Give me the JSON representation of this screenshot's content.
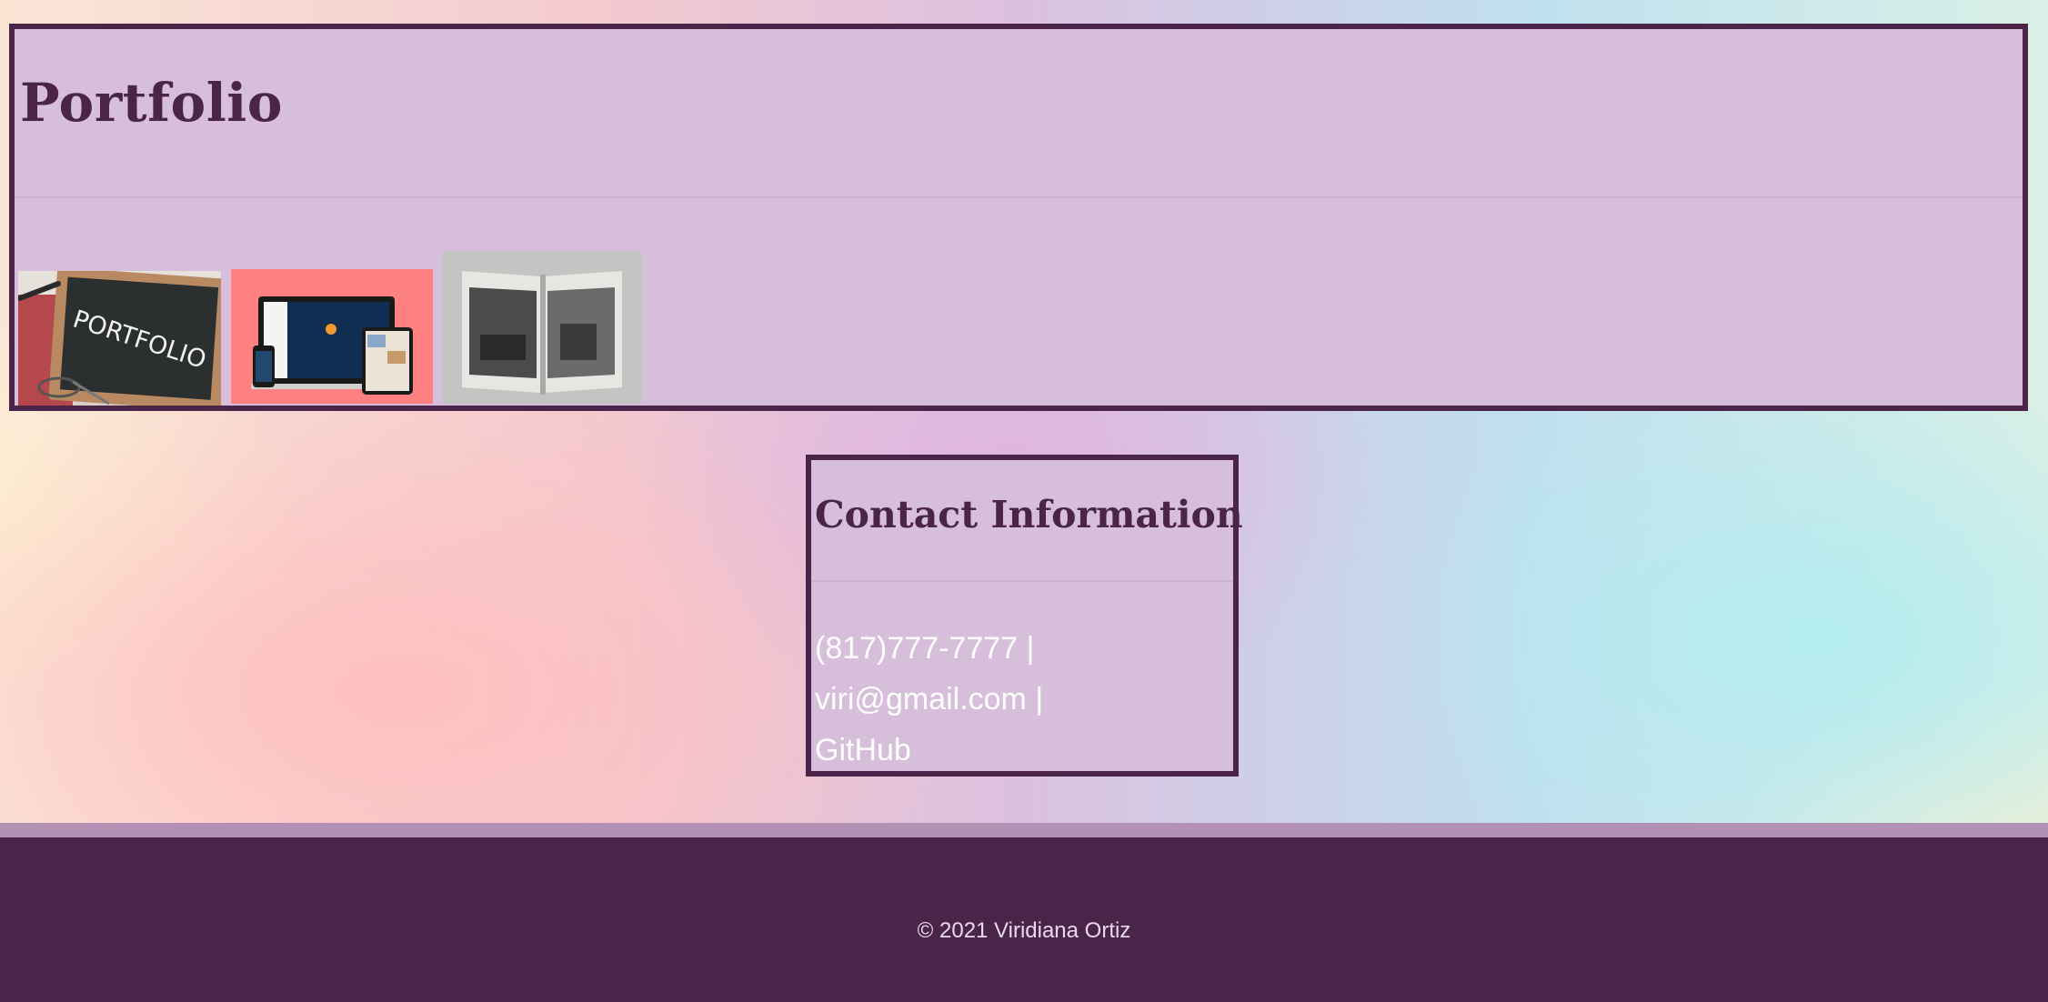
{
  "portfolio": {
    "title": "Portfolio",
    "images": [
      {
        "alt": "PORTFOLIO"
      },
      {
        "alt": "responsive devices"
      },
      {
        "alt": "open book"
      }
    ]
  },
  "contact": {
    "title": "Contact Information",
    "phone": "(817)777-7777",
    "separator": "|",
    "email": "viri@gmail.com",
    "github": "GitHub"
  },
  "footer": {
    "text": "© 2021 Viridiana Ortiz"
  },
  "colors": {
    "accent": "#4a2549",
    "panel": "#d7bedb",
    "stripe": "#b391b4"
  }
}
